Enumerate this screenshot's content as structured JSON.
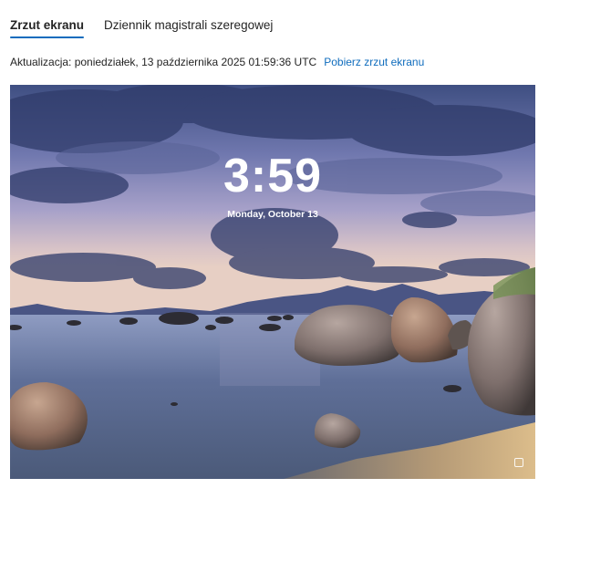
{
  "tabs": [
    {
      "label": "Zrzut ekranu",
      "active": true
    },
    {
      "label": "Dziennik magistrali szeregowej",
      "active": false
    }
  ],
  "update": {
    "text": "Aktualizacja: poniedziałek, 13 października 2025 01:59:36 UTC",
    "link": "Pobierz zrzut ekranu"
  },
  "lockscreen": {
    "time": "3:59",
    "date": "Monday, October 13",
    "corner_icon": "accessibility-icon"
  },
  "colors": {
    "accent": "#0f6cbd",
    "text": "#242424"
  }
}
